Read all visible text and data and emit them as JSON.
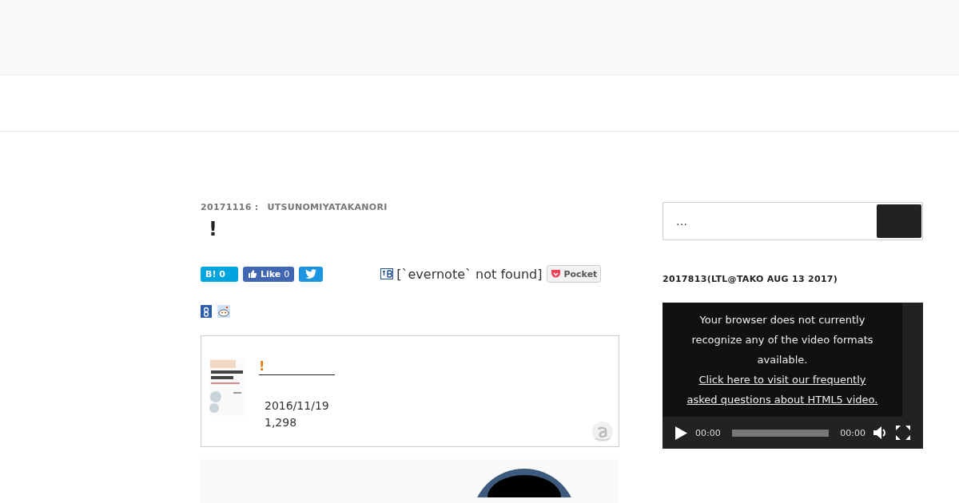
{
  "post": {
    "date": "20171116 :",
    "author": "UTSUNOMIYATAKANORI",
    "title": "!"
  },
  "share": {
    "hatena": {
      "mark": "B!",
      "count": "0"
    },
    "facebook": {
      "label": "Like",
      "count": "0"
    },
    "evernote_text": "[`evernote` not found]",
    "pocket": "Pocket"
  },
  "product": {
    "kind": "picture",
    "title": "!",
    "date": "2016/11/19",
    "price": "1,298"
  },
  "search": {
    "placeholder": "…"
  },
  "widget": {
    "title": "2017813(LTL@TAKO AUG 13 2017)",
    "video": {
      "message": "Your browser does not currently recognize any of the video formats available.",
      "link": "Click here to visit our frequently asked questions about HTML5 video.",
      "current_time": "00:00",
      "duration": "00:00"
    }
  }
}
